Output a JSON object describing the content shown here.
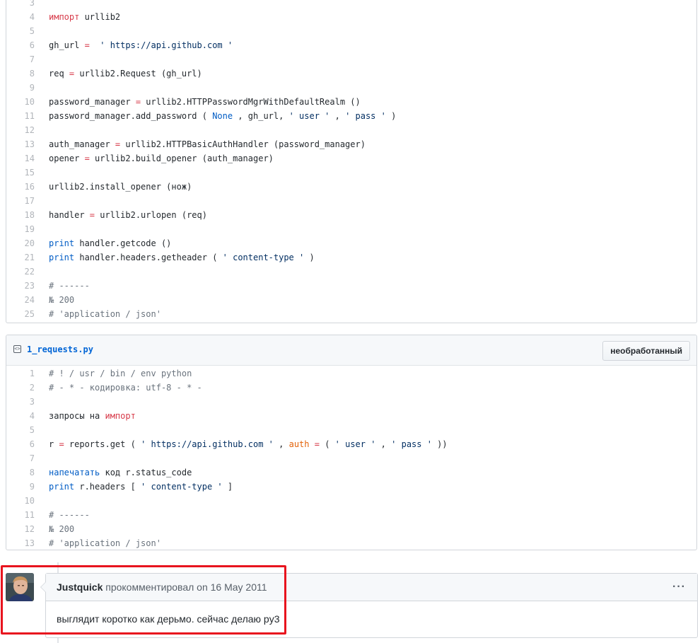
{
  "file1": {
    "lines": [
      {
        "n": "3",
        "tokens": []
      },
      {
        "n": "4",
        "tokens": [
          {
            "t": "импорт",
            "c": "k"
          },
          {
            "t": " urllib2",
            "c": ""
          }
        ]
      },
      {
        "n": "5",
        "tokens": []
      },
      {
        "n": "6",
        "tokens": [
          {
            "t": "gh_url ",
            "c": ""
          },
          {
            "t": "=",
            "c": "k"
          },
          {
            "t": "  ",
            "c": ""
          },
          {
            "t": "' https://api.github.com '",
            "c": "s"
          }
        ]
      },
      {
        "n": "7",
        "tokens": []
      },
      {
        "n": "8",
        "tokens": [
          {
            "t": "req ",
            "c": ""
          },
          {
            "t": "=",
            "c": "k"
          },
          {
            "t": " urllib2.Request (gh_url)",
            "c": ""
          }
        ]
      },
      {
        "n": "9",
        "tokens": []
      },
      {
        "n": "10",
        "tokens": [
          {
            "t": "password_manager ",
            "c": ""
          },
          {
            "t": "=",
            "c": "k"
          },
          {
            "t": " urllib2.HTTPPasswordMgrWithDefaultRealm ()",
            "c": ""
          }
        ]
      },
      {
        "n": "11",
        "tokens": [
          {
            "t": "password_manager.add_password ( ",
            "c": ""
          },
          {
            "t": "None",
            "c": "b"
          },
          {
            "t": " , gh_url, ",
            "c": ""
          },
          {
            "t": "' user '",
            "c": "s"
          },
          {
            "t": " , ",
            "c": ""
          },
          {
            "t": "' pass '",
            "c": "s"
          },
          {
            "t": " )",
            "c": ""
          }
        ]
      },
      {
        "n": "12",
        "tokens": []
      },
      {
        "n": "13",
        "tokens": [
          {
            "t": "auth_manager ",
            "c": ""
          },
          {
            "t": "=",
            "c": "k"
          },
          {
            "t": " urllib2.HTTPBasicAuthHandler (password_manager)",
            "c": ""
          }
        ]
      },
      {
        "n": "14",
        "tokens": [
          {
            "t": "opener ",
            "c": ""
          },
          {
            "t": "=",
            "c": "k"
          },
          {
            "t": " urllib2.build_opener (auth_manager)",
            "c": ""
          }
        ]
      },
      {
        "n": "15",
        "tokens": []
      },
      {
        "n": "16",
        "tokens": [
          {
            "t": "urllib2.install_opener (нож)",
            "c": ""
          }
        ]
      },
      {
        "n": "17",
        "tokens": []
      },
      {
        "n": "18",
        "tokens": [
          {
            "t": "handler ",
            "c": ""
          },
          {
            "t": "=",
            "c": "k"
          },
          {
            "t": " urllib2.urlopen (req)",
            "c": ""
          }
        ]
      },
      {
        "n": "19",
        "tokens": []
      },
      {
        "n": "20",
        "tokens": [
          {
            "t": "print",
            "c": "b"
          },
          {
            "t": " handler.getcode ()",
            "c": ""
          }
        ]
      },
      {
        "n": "21",
        "tokens": [
          {
            "t": "print",
            "c": "b"
          },
          {
            "t": " handler.headers.getheader ( ",
            "c": ""
          },
          {
            "t": "' content-type '",
            "c": "s"
          },
          {
            "t": " )",
            "c": ""
          }
        ]
      },
      {
        "n": "22",
        "tokens": []
      },
      {
        "n": "23",
        "tokens": [
          {
            "t": "# ------",
            "c": "c"
          }
        ]
      },
      {
        "n": "24",
        "tokens": [
          {
            "t": "№ 200",
            "c": "c"
          }
        ]
      },
      {
        "n": "25",
        "tokens": [
          {
            "t": "# 'application / json'",
            "c": "c"
          }
        ]
      }
    ]
  },
  "file2": {
    "filename": "1_requests.py",
    "raw_label": "необработанный",
    "lines": [
      {
        "n": "1",
        "tokens": [
          {
            "t": "# ! / usr / bin / env python",
            "c": "c"
          }
        ]
      },
      {
        "n": "2",
        "tokens": [
          {
            "t": "# - * - кодировка: utf-8 - * -",
            "c": "c"
          }
        ]
      },
      {
        "n": "3",
        "tokens": []
      },
      {
        "n": "4",
        "tokens": [
          {
            "t": "запросы на ",
            "c": ""
          },
          {
            "t": "импорт",
            "c": "k"
          }
        ]
      },
      {
        "n": "5",
        "tokens": []
      },
      {
        "n": "6",
        "tokens": [
          {
            "t": "r ",
            "c": ""
          },
          {
            "t": "=",
            "c": "k"
          },
          {
            "t": " reports.get ( ",
            "c": ""
          },
          {
            "t": "' https://api.github.com '",
            "c": "s"
          },
          {
            "t": " , ",
            "c": ""
          },
          {
            "t": "auth",
            "c": "o"
          },
          {
            "t": " ",
            "c": ""
          },
          {
            "t": "=",
            "c": "k"
          },
          {
            "t": " ( ",
            "c": ""
          },
          {
            "t": "' user '",
            "c": "s"
          },
          {
            "t": " , ",
            "c": ""
          },
          {
            "t": "' pass '",
            "c": "s"
          },
          {
            "t": " ))",
            "c": ""
          }
        ]
      },
      {
        "n": "7",
        "tokens": []
      },
      {
        "n": "8",
        "tokens": [
          {
            "t": "напечатать",
            "c": "b"
          },
          {
            "t": " код r.status_code",
            "c": ""
          }
        ]
      },
      {
        "n": "9",
        "tokens": [
          {
            "t": "print",
            "c": "b"
          },
          {
            "t": " r.headers [ ",
            "c": ""
          },
          {
            "t": "' content-type '",
            "c": "s"
          },
          {
            "t": " ]",
            "c": ""
          }
        ]
      },
      {
        "n": "10",
        "tokens": []
      },
      {
        "n": "11",
        "tokens": [
          {
            "t": "# ------",
            "c": "c"
          }
        ]
      },
      {
        "n": "12",
        "tokens": [
          {
            "t": "№ 200",
            "c": "c"
          }
        ]
      },
      {
        "n": "13",
        "tokens": [
          {
            "t": "# 'application / json'",
            "c": "c"
          }
        ]
      }
    ]
  },
  "comment": {
    "author": "Justquick",
    "action": " прокомментировал ",
    "date": "on 16 May 2011",
    "menu": "···",
    "body": "выглядит коротко как дерьмо. сейчас делаю py3"
  },
  "colors": {
    "keyword": "#d73a49",
    "builtin": "#005cc5",
    "string": "#032f62",
    "comment": "#6a737d",
    "highlight_border": "#e8141e"
  }
}
